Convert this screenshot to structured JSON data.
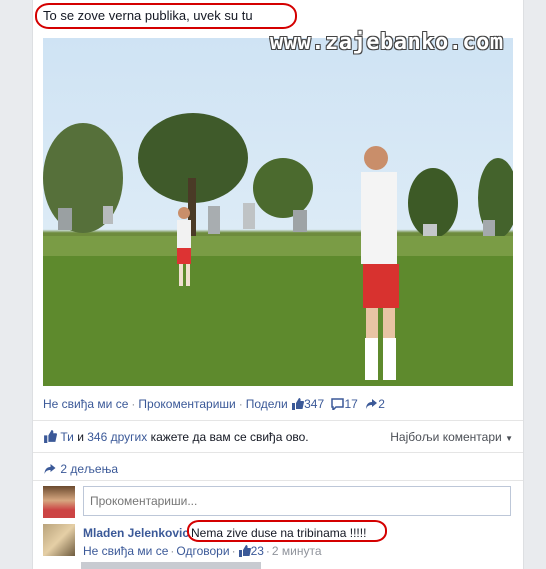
{
  "post": {
    "text": "To se zove verna publika, uvek su tu"
  },
  "watermark": "www.zajebanko.com",
  "actions": {
    "unlike": "Не свиђа ми се",
    "comment": "Прокоментариши",
    "share": "Подели",
    "likes_count": "347",
    "comments_count": "17",
    "shares_count": "2"
  },
  "likes_summary": {
    "you": "Ти",
    "and": "и",
    "others": "346 других",
    "rest": "кажете да вам се свиђа ово."
  },
  "top_comments": "Најбољи коментари",
  "shares_text": "2 дељења",
  "comment_input": {
    "placeholder": "Прокоментариши..."
  },
  "comment": {
    "author": "Mladen Jelenkovic",
    "text": "Nema zive duse na tribinama !!!!!",
    "unlike": "Не свиђа ми се",
    "reply": "Одговори",
    "likes": "23",
    "time": "2 минута"
  },
  "colors": {
    "link": "#3b5998",
    "highlight": "#d40000"
  }
}
